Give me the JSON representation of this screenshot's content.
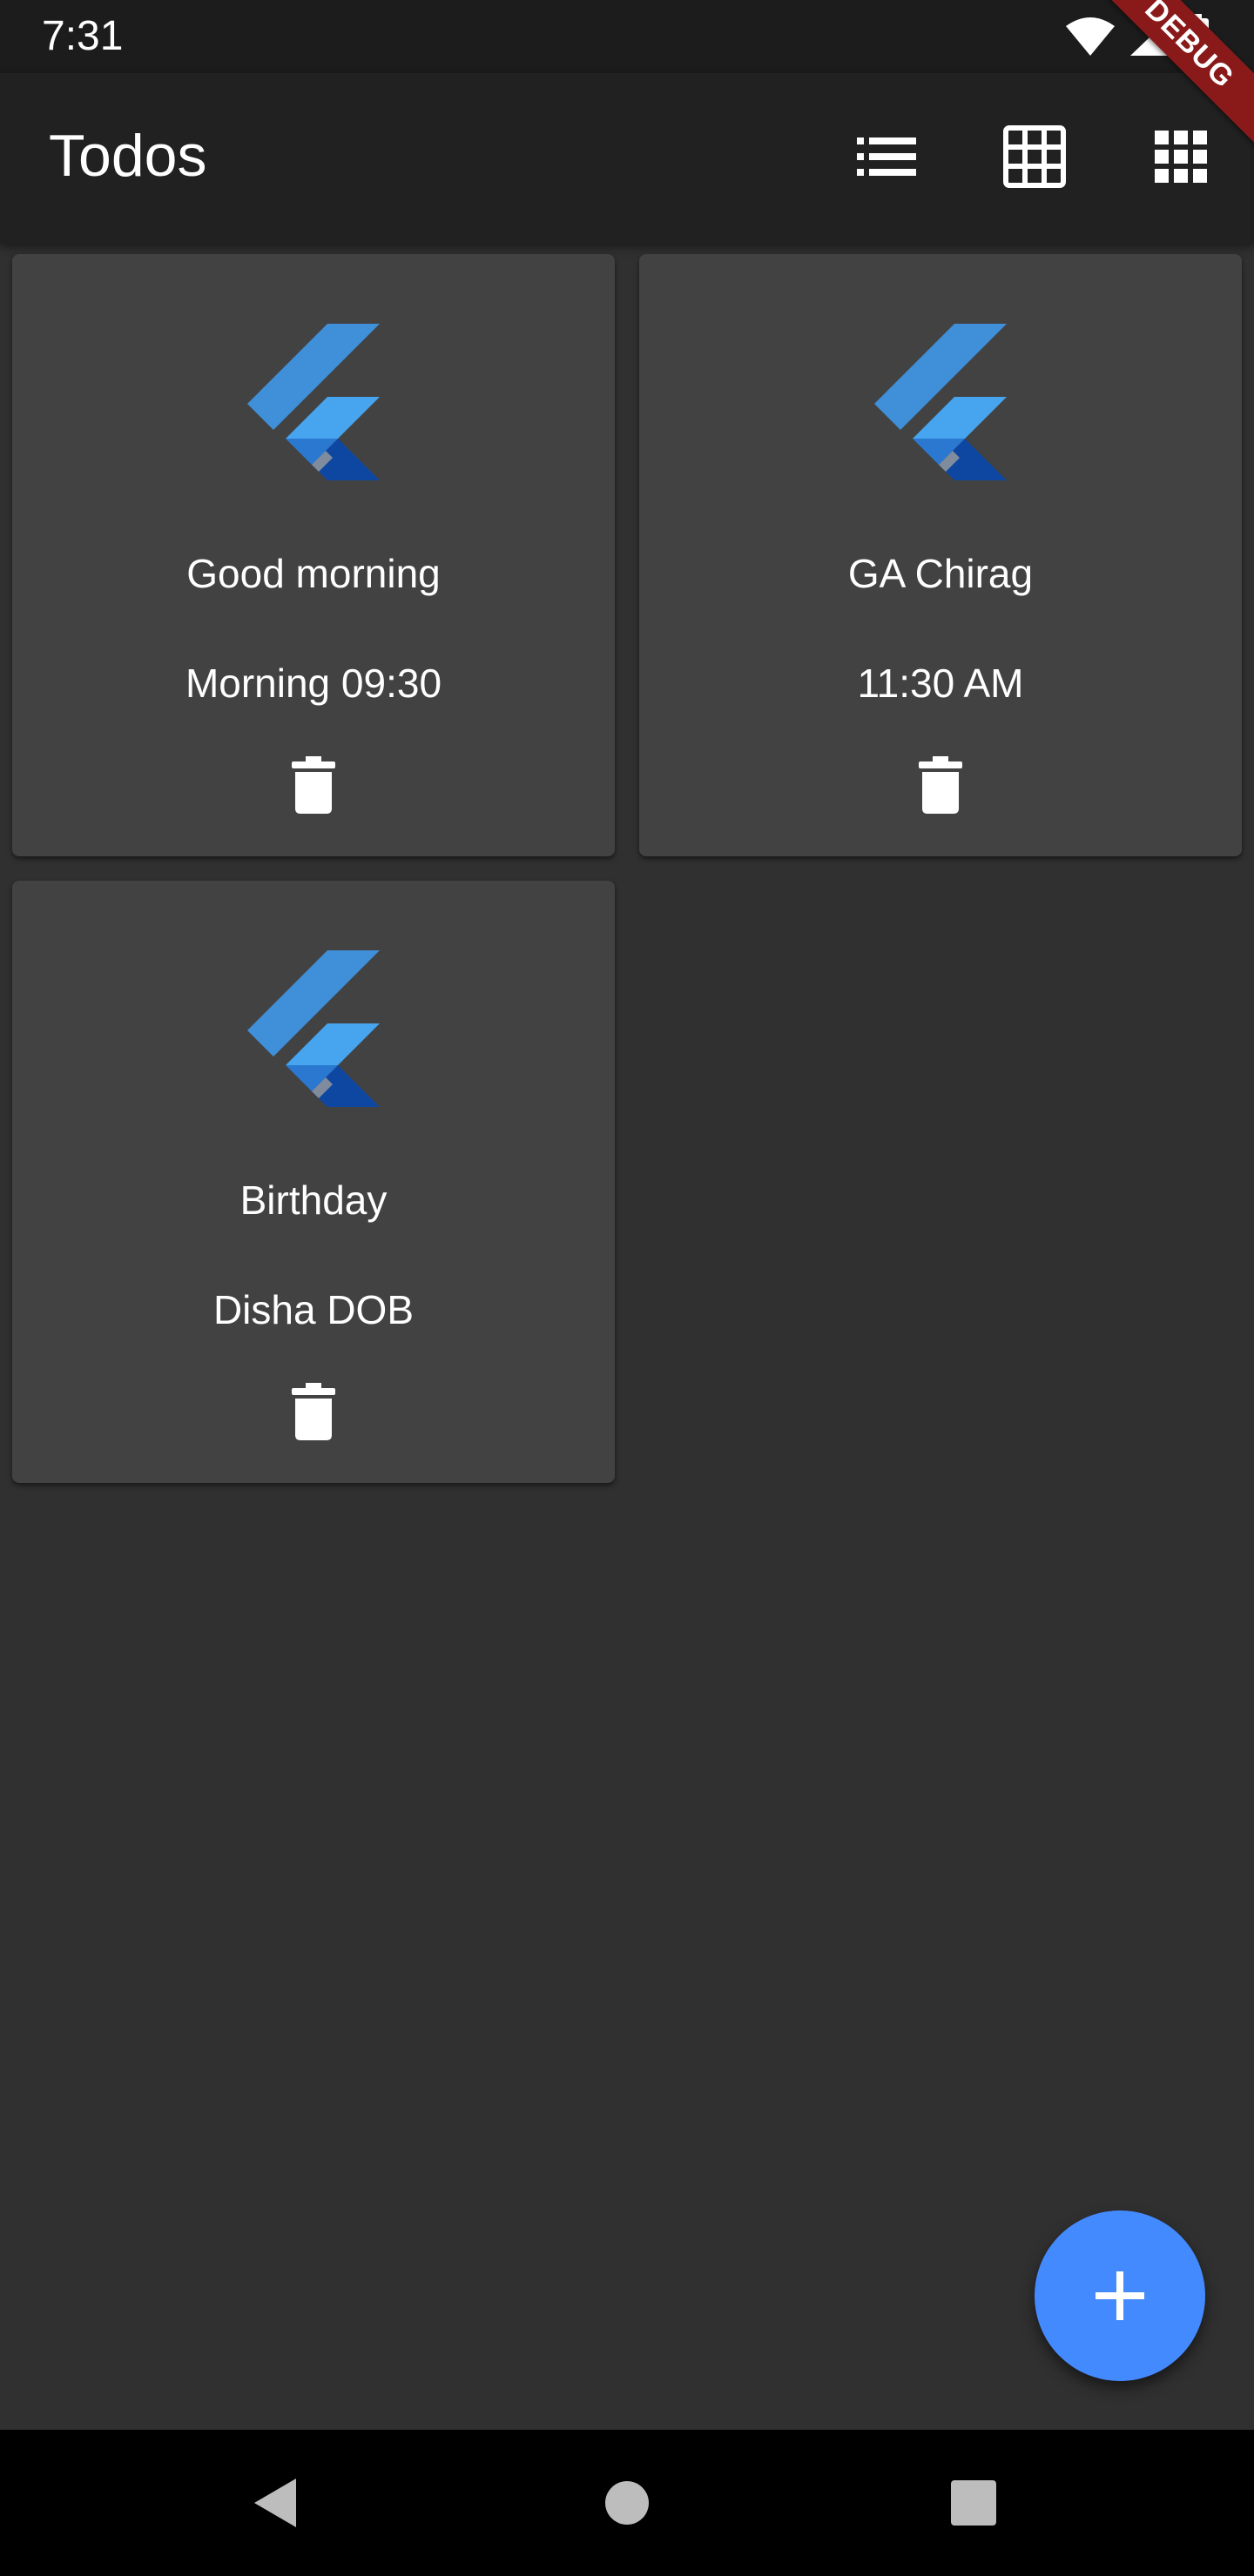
{
  "status_bar": {
    "time": "7:31",
    "icons": [
      "wifi-icon",
      "cell-signal-icon",
      "battery-charging-icon"
    ]
  },
  "app_bar": {
    "title": "Todos",
    "actions": [
      "list-view-icon",
      "grid-view-icon",
      "dense-grid-view-icon"
    ],
    "background": "#212121"
  },
  "debug_banner": "DEBUG",
  "todos": [
    {
      "title": "Good morning",
      "description": "Morning 09:30",
      "icon": "flutter-logo-icon"
    },
    {
      "title": "GA Chirag",
      "description": "11:30 AM",
      "icon": "flutter-logo-icon"
    },
    {
      "title": "Birthday",
      "description": "Disha DOB",
      "icon": "flutter-logo-icon"
    }
  ],
  "fab": {
    "icon": "add-icon",
    "color": "#448aff"
  },
  "nav_bar": {
    "icons": [
      "back-icon",
      "home-icon",
      "recents-icon"
    ]
  },
  "colors": {
    "background": "#303030",
    "card": "#424242"
  }
}
